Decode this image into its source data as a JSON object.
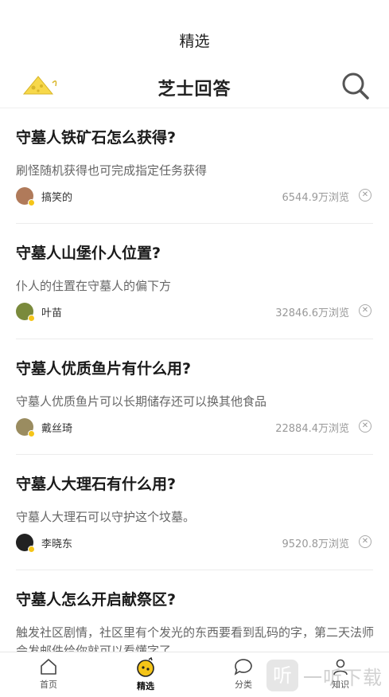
{
  "top_bar": {
    "title": "精选"
  },
  "header": {
    "title": "芝士回答",
    "logo_icon": "cheese-logo",
    "search_icon": "search-icon"
  },
  "feed": [
    {
      "question": "守墓人铁矿石怎么获得?",
      "answer": "刷怪随机获得也可完成指定任务获得",
      "author": "搞笑的",
      "views": "6544.9万浏览"
    },
    {
      "question": "守墓人山堡仆人位置?",
      "answer": "仆人的住置在守墓人的偏下方",
      "author": "叶苗",
      "views": "32846.6万浏览"
    },
    {
      "question": "守墓人优质鱼片有什么用?",
      "answer": "守墓人优质鱼片可以长期储存还可以换其他食品",
      "author": "戴丝琦",
      "views": "22884.4万浏览"
    },
    {
      "question": "守墓人大理石有什么用?",
      "answer": "守墓人大理石可以守护这个坟墓。",
      "author": "李晓东",
      "views": "9520.8万浏览"
    },
    {
      "question": "守墓人怎么开启献祭区?",
      "answer": "触发社区剧情，社区里有个发光的东西要看到乱码的字，第二天法师会发邮件给你就可以看懂字了。"
    }
  ],
  "tabbar": {
    "items": [
      {
        "label": "首页",
        "icon": "home-icon"
      },
      {
        "label": "精选",
        "icon": "featured-icon",
        "active": true
      },
      {
        "label": "分类",
        "icon": "chat-bubble-icon"
      },
      {
        "label": "知识",
        "icon": "user-icon"
      }
    ]
  },
  "watermark": {
    "text": "一听下载"
  },
  "colors": {
    "accent": "#f5c518",
    "text": "#222222",
    "muted": "#999999"
  }
}
